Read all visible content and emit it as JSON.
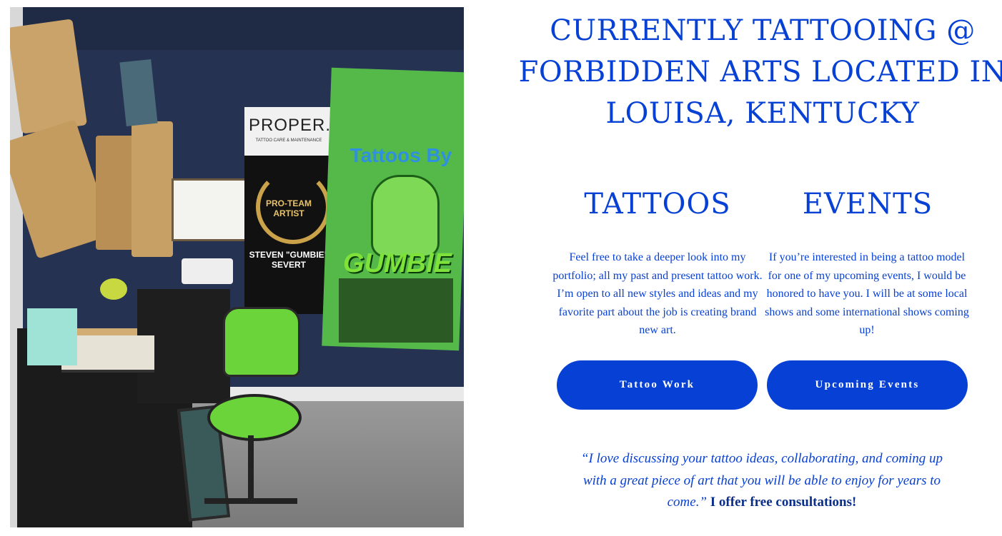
{
  "photo": {
    "banner_proper": "PROPER.",
    "banner_proper_sub": "TATTOO CARE & MAINTENANCE",
    "banner_proteam": "PRO-TEAM ARTIST",
    "banner_artist": "STEVEN \"GUMBIE\" SEVERT",
    "banner_gumbie_title": "Tattoos By",
    "banner_gumbie_word": "GUMBIE"
  },
  "headline": {
    "line1": "CURRENTLY TATTOOING @",
    "line2": "FORBIDDEN ARTS LOCATED IN",
    "line3": "LOUISA, KENTUCKY"
  },
  "tattoos": {
    "title": "TATTOOS",
    "text": "Feel free to take a deeper look into my portfolio; all my past and present tattoo work. I’m open to all new styles and ideas and my favorite part about the job is creating brand new art.",
    "button_label": "Tattoo Work"
  },
  "events": {
    "title": "EVENTS",
    "text": "If you’re interested in being a tattoo model for one of my upcoming events, I would be honored to have you. I will be at some local shows and some international shows coming up!",
    "button_label": "Upcoming Events"
  },
  "quote": {
    "italic": "“I love discussing your tattoo ideas, collaborating, and coming up with a great piece of art that you will be able to enjoy for years to come.”",
    "strong": "I offer free consultations",
    "end": "!"
  },
  "colors": {
    "accent": "#0740d4",
    "button_text": "#ffffff"
  }
}
